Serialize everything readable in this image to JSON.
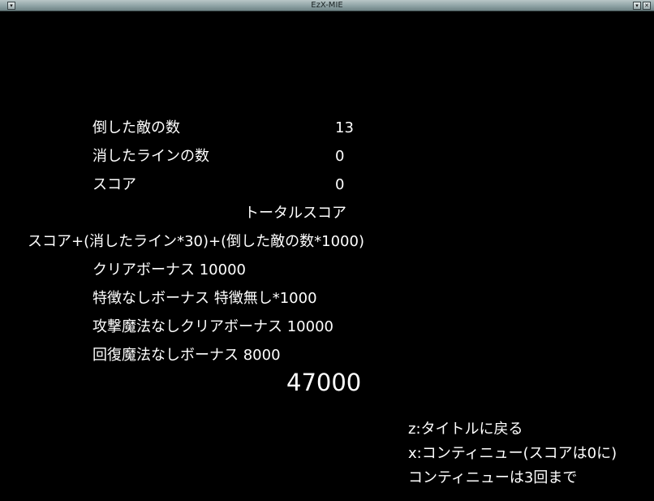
{
  "window": {
    "title": "EzX-MIE"
  },
  "results": {
    "enemies_label": "倒した敵の数",
    "enemies_value": "13",
    "lines_label": "消したラインの数",
    "lines_value": "0",
    "score_label": "スコア",
    "score_value": "0",
    "total_heading": "トータルスコア",
    "formula": "スコア+(消したライン*30)+(倒した敵の数*1000)",
    "bonuses": [
      "クリアボーナス 10000",
      "特徴なしボーナス 特徴無し*1000",
      "攻撃魔法なしクリアボーナス 10000",
      "回復魔法なしボーナス 8000"
    ],
    "total": "47000"
  },
  "controls": {
    "z_line": "z:タイトルに戻る",
    "x_line": "x:コンティニュー(スコアは0に)",
    "continue_note": "コンティニューは3回まで"
  },
  "colors": {
    "background": "#000000",
    "text": "#ffffff",
    "titlebar": "#8fa3a5"
  }
}
